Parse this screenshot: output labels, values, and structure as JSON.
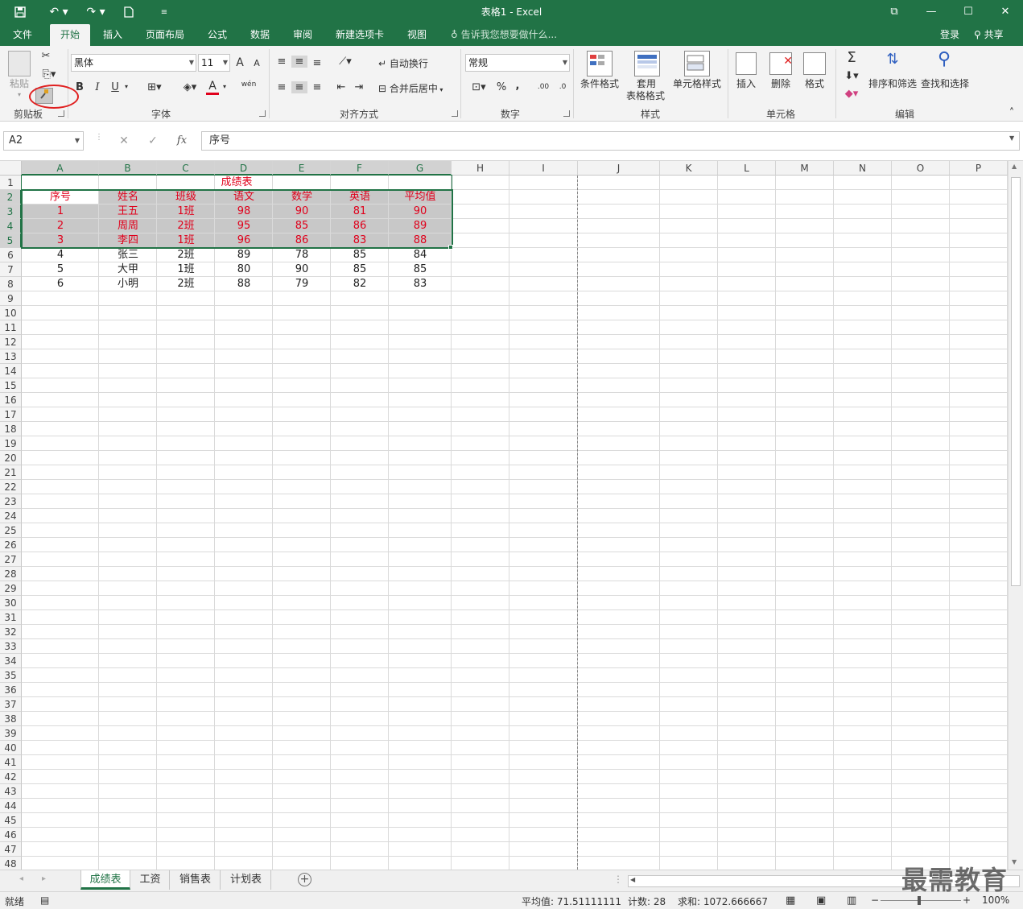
{
  "window": {
    "title": "表格1 - Excel",
    "quick_access": [
      "save-icon",
      "undo-icon",
      "redo-icon",
      "new-file-icon",
      "customize-icon"
    ],
    "controls": [
      "ribbon-display-icon",
      "minimize-icon",
      "maximize-icon",
      "close-icon"
    ]
  },
  "tabs": [
    {
      "label": "文件"
    },
    {
      "label": "开始"
    },
    {
      "label": "插入"
    },
    {
      "label": "页面布局"
    },
    {
      "label": "公式"
    },
    {
      "label": "数据"
    },
    {
      "label": "审阅"
    },
    {
      "label": "新建选项卡"
    },
    {
      "label": "视图"
    }
  ],
  "active_tab": "开始",
  "tell_me": "告诉我您想要做什么...",
  "account": {
    "login": "登录",
    "share": "共享"
  },
  "ribbon": {
    "clipboard": {
      "label": "剪贴板",
      "paste": "粘贴"
    },
    "font": {
      "label": "字体",
      "font_name": "黑体",
      "font_size": "11",
      "bold": "B",
      "italic": "I",
      "underline": "U",
      "font_color_glyph": "A",
      "grow": "A",
      "shrink": "A",
      "phonetic": "wén"
    },
    "alignment": {
      "label": "对齐方式",
      "wrap_text": "自动换行",
      "merge_center": "合并后居中"
    },
    "number": {
      "label": "数字",
      "format": "常规",
      "percent": "%",
      "comma": ",",
      "inc_decimal": ".00",
      "dec_decimal": ".0"
    },
    "styles": {
      "label": "样式",
      "conditional": "条件格式",
      "table_format_1": "套用",
      "table_format_2": "表格格式",
      "cell_styles": "单元格样式"
    },
    "cells": {
      "label": "单元格",
      "insert": "插入",
      "delete": "删除",
      "format": "格式"
    },
    "editing": {
      "label": "编辑",
      "autosum": "Σ",
      "sort_filter": "排序和筛选",
      "find_select": "查找和选择"
    }
  },
  "formula_bar": {
    "name_box": "A2",
    "fx": "fx",
    "content": "序号"
  },
  "columns": [
    "A",
    "B",
    "C",
    "D",
    "E",
    "F",
    "G",
    "H",
    "I",
    "J",
    "K",
    "L",
    "M",
    "N",
    "O",
    "P"
  ],
  "rows": [
    "1",
    "2",
    "3",
    "4",
    "5",
    "6",
    "7",
    "8",
    "9",
    "10",
    "11",
    "12",
    "13",
    "14",
    "15",
    "16",
    "17",
    "18",
    "19",
    "20",
    "21",
    "22",
    "23",
    "24",
    "25",
    "26",
    "27",
    "28",
    "29",
    "30",
    "31",
    "32",
    "33",
    "34",
    "35",
    "36",
    "37",
    "38",
    "39",
    "40",
    "41",
    "42",
    "43",
    "44",
    "45",
    "46",
    "47",
    "48"
  ],
  "sheet": {
    "title": "成绩表",
    "headers": [
      "序号",
      "姓名",
      "班级",
      "语文",
      "数学",
      "英语",
      "平均值"
    ],
    "data": [
      [
        "1",
        "王五",
        "1班",
        "98",
        "90",
        "81",
        "90"
      ],
      [
        "2",
        "周周",
        "2班",
        "95",
        "85",
        "86",
        "89"
      ],
      [
        "3",
        "李四",
        "1班",
        "96",
        "86",
        "83",
        "88"
      ],
      [
        "4",
        "张三",
        "2班",
        "89",
        "78",
        "85",
        "84"
      ],
      [
        "5",
        "大甲",
        "1班",
        "80",
        "90",
        "85",
        "85"
      ],
      [
        "6",
        "小明",
        "2班",
        "88",
        "79",
        "82",
        "83"
      ]
    ]
  },
  "sheet_tabs": [
    "成绩表",
    "工资",
    "销售表",
    "计划表"
  ],
  "active_sheet": "成绩表",
  "status": {
    "ready": "就绪",
    "average": "平均值: 71.51111111",
    "count": "计数: 28",
    "sum": "求和: 1072.666667",
    "zoom": "100%"
  },
  "watermark": "最需教育",
  "colors": {
    "excel_green": "#217346",
    "red_text": "#e0001b",
    "selection_shade": "#c8c8c8",
    "annotation_red": "#e02020"
  }
}
